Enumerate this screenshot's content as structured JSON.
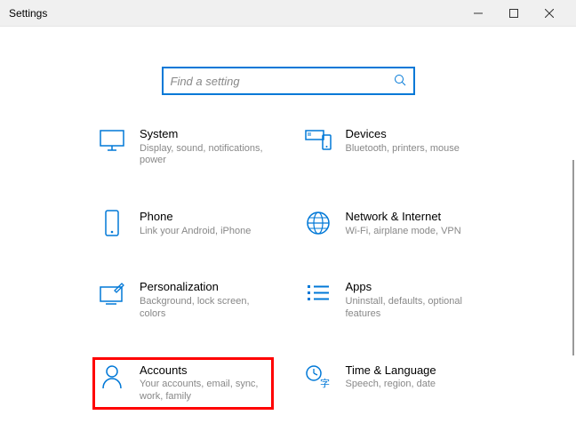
{
  "window": {
    "title": "Settings"
  },
  "search": {
    "placeholder": "Find a setting"
  },
  "categories": [
    {
      "id": "system",
      "label": "System",
      "desc": "Display, sound, notifications, power"
    },
    {
      "id": "devices",
      "label": "Devices",
      "desc": "Bluetooth, printers, mouse"
    },
    {
      "id": "phone",
      "label": "Phone",
      "desc": "Link your Android, iPhone"
    },
    {
      "id": "network",
      "label": "Network & Internet",
      "desc": "Wi-Fi, airplane mode, VPN"
    },
    {
      "id": "personalization",
      "label": "Personalization",
      "desc": "Background, lock screen, colors"
    },
    {
      "id": "apps",
      "label": "Apps",
      "desc": "Uninstall, defaults, optional features"
    },
    {
      "id": "accounts",
      "label": "Accounts",
      "desc": "Your accounts, email, sync, work, family"
    },
    {
      "id": "time",
      "label": "Time & Language",
      "desc": "Speech, region, date"
    }
  ],
  "highlighted": "accounts",
  "colors": {
    "accent": "#0078d7",
    "highlight": "#ff0000"
  }
}
